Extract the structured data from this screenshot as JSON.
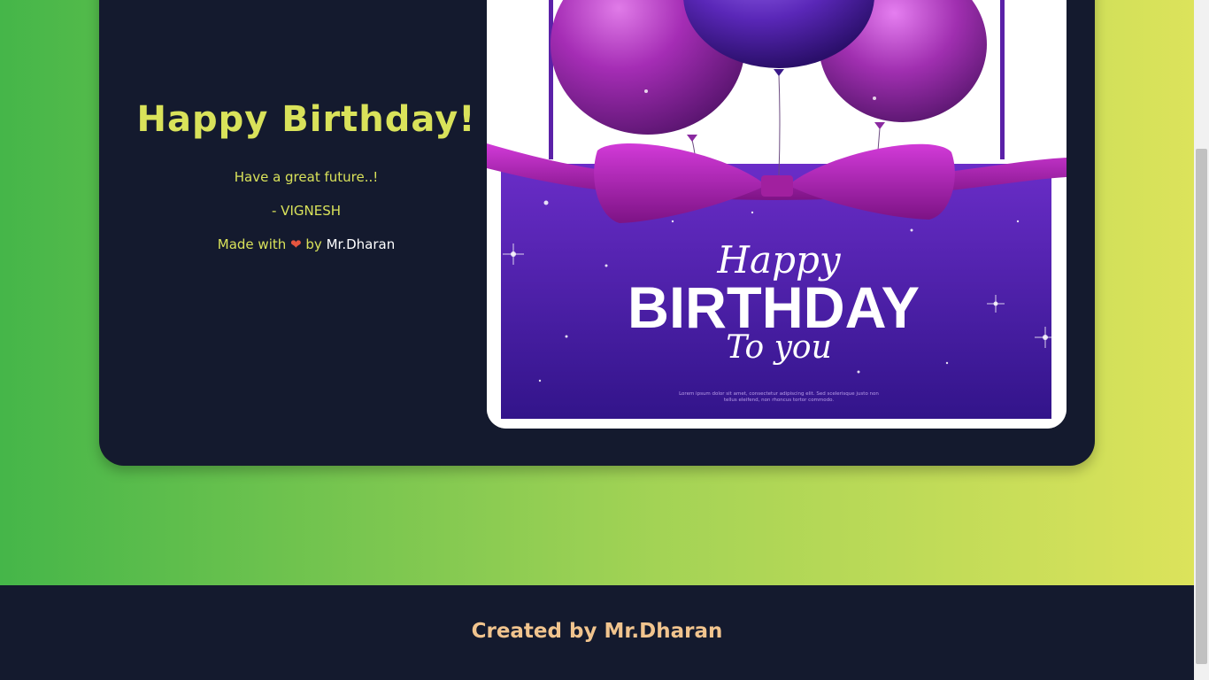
{
  "card": {
    "title": "Happy Birthday!",
    "wish": "Have a great future..!",
    "sender": "- VIGNESH",
    "made_with_prefix": "Made with",
    "heart_glyph": "❤",
    "made_with_by": "by",
    "author": "Mr.Dharan"
  },
  "image": {
    "icon": "birthday-card-image",
    "happy": "Happy",
    "birthday": "BIRTHDAY",
    "to_you": "To you",
    "fine_print_1": "Lorem ipsum dolor sit amet, consectetur adipiscing elit. Sed scelerisque justo non",
    "fine_print_2": "tellus eleifend, non rhoncus tortor commodo."
  },
  "footer": {
    "text": "Created by Mr.Dharan"
  },
  "colors": {
    "gradient_start": "#45b649",
    "gradient_end": "#dce35b",
    "card_bg": "#141a2e",
    "title": "#d9e25a",
    "footer_text": "#f1c48e",
    "heart": "#e6553f"
  }
}
